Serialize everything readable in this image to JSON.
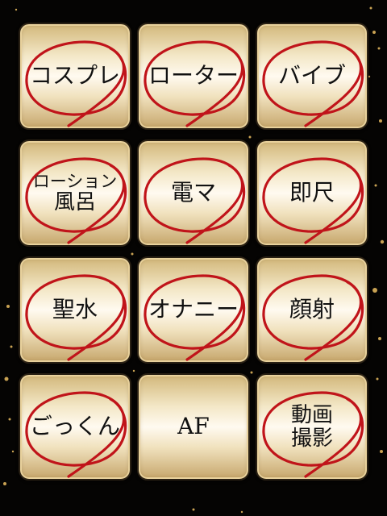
{
  "tiles": [
    {
      "line1": "コスプレ",
      "line2": "",
      "circled": true
    },
    {
      "line1": "ローター",
      "line2": "",
      "circled": true
    },
    {
      "line1": "バイブ",
      "line2": "",
      "circled": true
    },
    {
      "line1": "ローション",
      "line2": "風呂",
      "circled": true
    },
    {
      "line1": "電マ",
      "line2": "",
      "circled": true
    },
    {
      "line1": "即尺",
      "line2": "",
      "circled": true
    },
    {
      "line1": "聖水",
      "line2": "",
      "circled": true
    },
    {
      "line1": "オナニー",
      "line2": "",
      "circled": true
    },
    {
      "line1": "顔射",
      "line2": "",
      "circled": true
    },
    {
      "line1": "ごっくん",
      "line2": "",
      "circled": true
    },
    {
      "line1": "AF",
      "line2": "",
      "circled": false
    },
    {
      "line1": "動画",
      "line2": "撮影",
      "circled": true
    }
  ],
  "colors": {
    "circle": "#c0141a",
    "tile_light": "#fffaf0",
    "tile_gold": "#d2b77a",
    "background": "#050403"
  }
}
